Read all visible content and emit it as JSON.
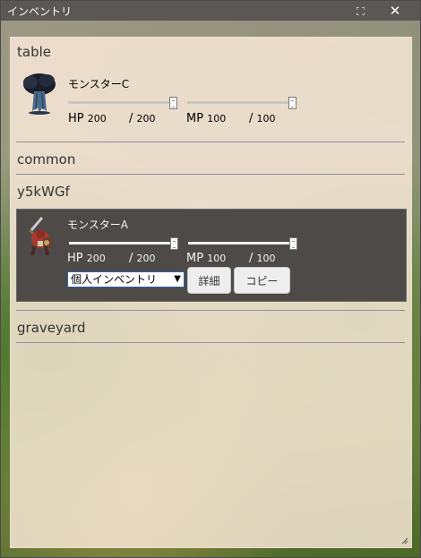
{
  "window": {
    "title": "インベントリ",
    "maximize_icon": "maximize-icon",
    "close_label": "✕"
  },
  "sections": [
    {
      "name": "table"
    },
    {
      "name": "common"
    },
    {
      "name": "y5kWGf"
    },
    {
      "name": "graveyard"
    }
  ],
  "cards": {
    "monster_c": {
      "name": "モンスターC",
      "hp_label": "HP",
      "hp_current": "200",
      "hp_max": "200",
      "mp_label": "MP",
      "mp_current": "100",
      "mp_max": "100",
      "sep": "/",
      "hp_fraction": 1.0,
      "mp_fraction": 1.0
    },
    "monster_a": {
      "name": "モンスターA",
      "hp_label": "HP",
      "hp_current": "200",
      "hp_max": "200",
      "mp_label": "MP",
      "mp_current": "100",
      "mp_max": "100",
      "sep": "/",
      "hp_fraction": 1.0,
      "mp_fraction": 1.0,
      "inventory_select_value": "個人インベントリ",
      "details_label": "詳細",
      "copy_label": "コピー"
    }
  },
  "colors": {
    "titlebar": "#5b5754",
    "selected_card": "#4d4a47",
    "select_border": "#2f5fb0"
  }
}
